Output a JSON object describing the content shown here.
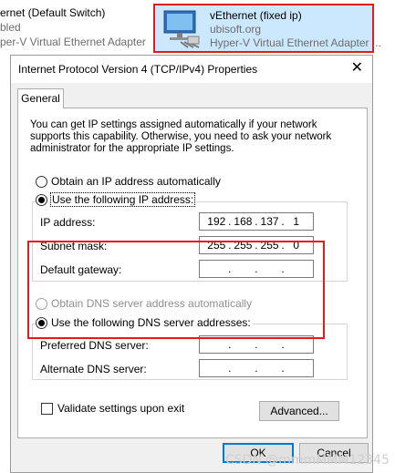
{
  "background": {
    "left_adapter": {
      "name": "ernet (Default Switch)",
      "status": "bled",
      "device": "per-V Virtual Ethernet Adapter"
    },
    "right_adapter": {
      "name": "vEthernet (fixed ip)",
      "network": "ubisoft.org",
      "device": "Hyper-V Virtual Ethernet Adapter ..."
    }
  },
  "dialog": {
    "title": "Internet Protocol Version 4 (TCP/IPv4) Properties",
    "close_label": "✕",
    "tab_general": "General",
    "intro": "You can get IP settings assigned automatically if your network supports this capability. Otherwise, you need to ask your network administrator for the appropriate IP settings.",
    "ip_auto_label": "Obtain an IP address automatically",
    "ip_manual_label": "Use the following IP address:",
    "ip_address_label": "IP address:",
    "subnet_label": "Subnet mask:",
    "gateway_label": "Default gateway:",
    "ip_address": [
      "192",
      "168",
      "137",
      "1"
    ],
    "subnet_mask": [
      "255",
      "255",
      "255",
      "0"
    ],
    "gateway": [
      "",
      "",
      "",
      ""
    ],
    "dns_auto_label": "Obtain DNS server address automatically",
    "dns_manual_label": "Use the following DNS server addresses:",
    "preferred_dns_label": "Preferred DNS server:",
    "alternate_dns_label": "Alternate DNS server:",
    "preferred_dns": [
      "",
      "",
      "",
      ""
    ],
    "alternate_dns": [
      "",
      "",
      "",
      ""
    ],
    "validate_label": "Validate settings upon exit",
    "advanced_label": "Advanced...",
    "ok_label": "OK",
    "cancel_label": "Cancel"
  },
  "watermark": "CSDN @mmmMMM12345",
  "colors": {
    "highlight_outline": "#e21b1b",
    "selection_bg": "#cce8ff",
    "default_button_border": "#0078d7"
  }
}
